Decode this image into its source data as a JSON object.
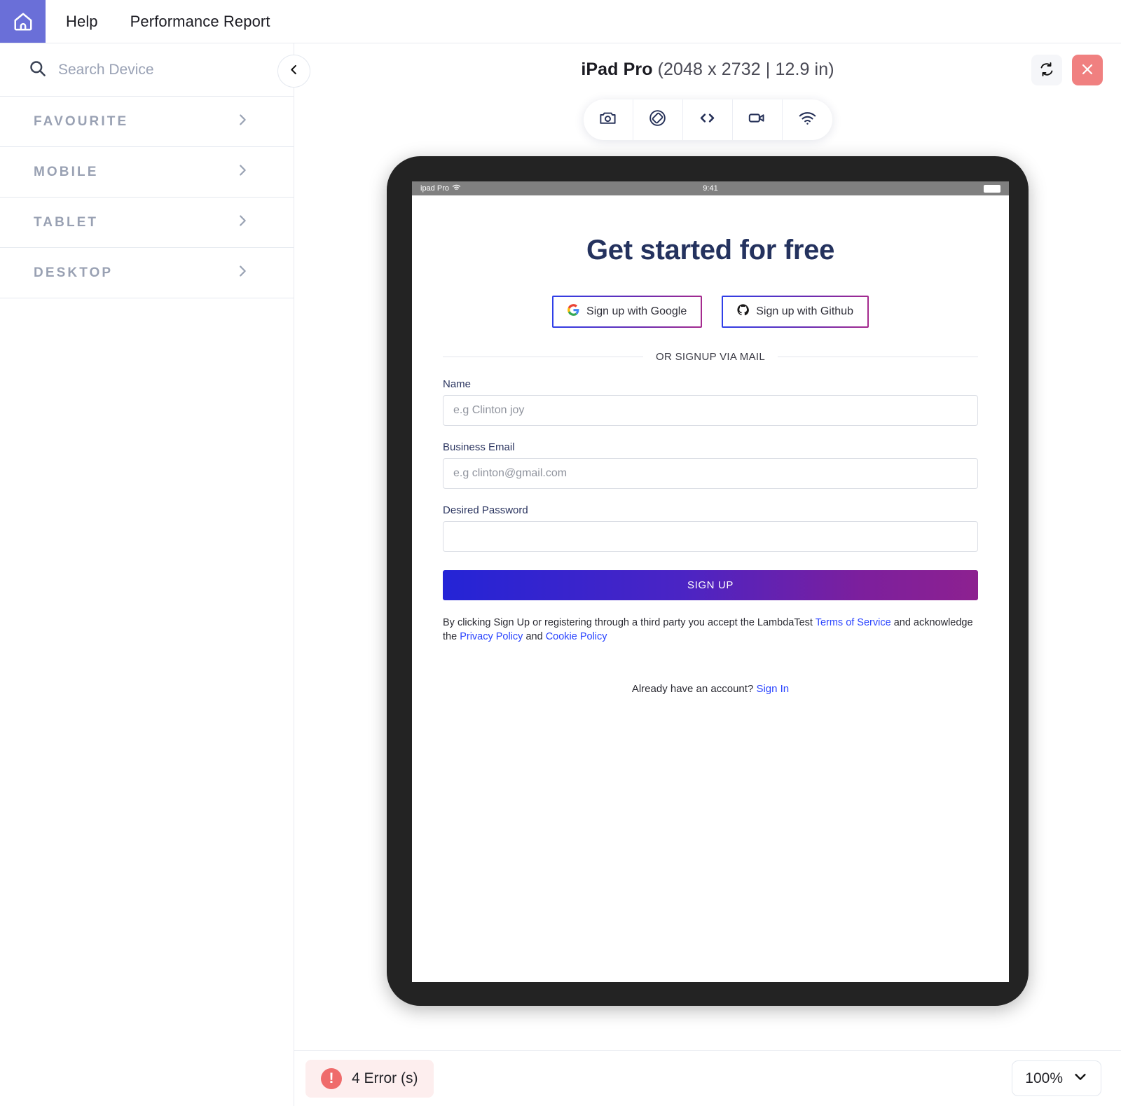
{
  "appbar": {
    "home_icon": "home-icon",
    "links": [
      {
        "label": "Help"
      },
      {
        "label": "Performance Report"
      }
    ]
  },
  "sidebar": {
    "search": {
      "icon": "search-icon",
      "placeholder": "Search Device",
      "value": ""
    },
    "collapse_icon": "chevron-left-icon",
    "categories": [
      {
        "label": "FAVOURITE",
        "chevron": "chevron-right-icon"
      },
      {
        "label": "MOBILE",
        "chevron": "chevron-right-icon"
      },
      {
        "label": "TABLET",
        "chevron": "chevron-right-icon"
      },
      {
        "label": "DESKTOP",
        "chevron": "chevron-right-icon"
      }
    ]
  },
  "stage": {
    "device_name": "iPad Pro",
    "device_spec": "(2048 x 2732 | 12.9 in)",
    "refresh_icon": "refresh-icon",
    "close_icon": "close-icon",
    "toolbar": [
      {
        "name": "screenshot-icon"
      },
      {
        "name": "rotate-device-icon"
      },
      {
        "name": "code-inspector-icon"
      },
      {
        "name": "record-video-icon"
      },
      {
        "name": "network-throttle-icon"
      }
    ]
  },
  "device_screen": {
    "statusbar": {
      "carrier": "ipad Pro",
      "wifi_icon": "wifi-icon",
      "time": "9:41",
      "battery_icon": "battery-icon"
    },
    "page": {
      "heading": "Get started for free",
      "social_buttons": [
        {
          "label": "Sign up with Google",
          "icon": "google-icon"
        },
        {
          "label": "Sign up with Github",
          "icon": "github-icon"
        }
      ],
      "divider_text": "OR SIGNUP VIA MAIL",
      "fields": [
        {
          "label": "Name",
          "placeholder": "e.g Clinton joy",
          "value": ""
        },
        {
          "label": "Business Email",
          "placeholder": "e.g clinton@gmail.com",
          "value": ""
        },
        {
          "label": "Desired Password",
          "placeholder": "",
          "value": ""
        }
      ],
      "submit_label": "SIGN UP",
      "legal": {
        "part1": "By clicking Sign Up or registering through a third party you accept the LambdaTest ",
        "link_terms": "Terms of Service",
        "part2": " and acknowledge the ",
        "link_privacy": "Privacy Policy",
        "part3": " and ",
        "link_cookie": "Cookie Policy"
      },
      "signin": {
        "text": "Already have an account? ",
        "link": "Sign In"
      }
    }
  },
  "bottombar": {
    "error_badge_icon": "alert-icon",
    "error_mark": "!",
    "error_label": "4 Error (s)",
    "zoom_value": "100%",
    "zoom_chevron": "chevron-down-icon"
  },
  "colors": {
    "brand_indigo": "#6a6fd8",
    "heading_navy": "#24325e",
    "link_blue": "#2a44ff",
    "error_red": "#ef6b6b",
    "close_red": "#f08080",
    "gradient_start": "#2424d6",
    "gradient_end": "#8d2190"
  }
}
